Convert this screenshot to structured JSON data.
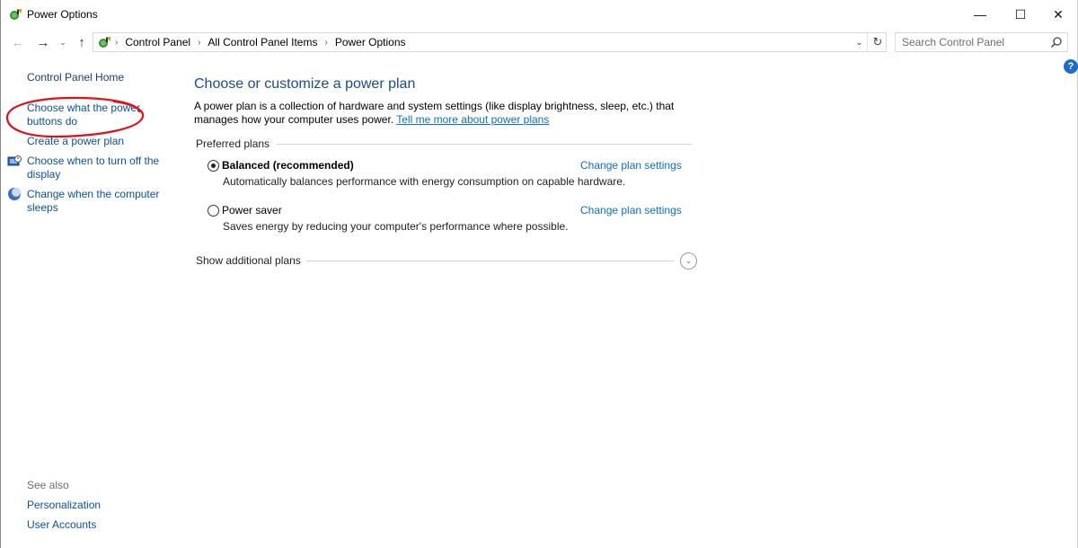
{
  "window": {
    "title": "Power Options",
    "minimize_glyph": "—",
    "maximize_glyph": "☐",
    "close_glyph": "✕"
  },
  "nav": {
    "back_glyph": "←",
    "forward_glyph": "→",
    "recent_glyph": "⌄",
    "up_glyph": "↑",
    "breadcrumb": [
      "Control Panel",
      "All Control Panel Items",
      "Power Options"
    ],
    "separator": "›",
    "dropdown_glyph": "⌄",
    "refresh_glyph": "↻"
  },
  "search": {
    "placeholder": "Search Control Panel"
  },
  "help": {
    "glyph": "?"
  },
  "sidebar": {
    "home": "Control Panel Home",
    "items": [
      "Choose what the power buttons do",
      "Create a power plan",
      "Choose when to turn off the display",
      "Change when the computer sleeps"
    ],
    "see_also_heading": "See also",
    "see_also": [
      "Personalization",
      "User Accounts"
    ]
  },
  "annotation": {
    "color": "#e0101a",
    "shape": "hand-drawn ellipse around sidebar item 1"
  },
  "main": {
    "title": "Choose or customize a power plan",
    "description": "A power plan is a collection of hardware and system settings (like display brightness, sleep, etc.) that manages how your computer uses power.",
    "learn_more": "Tell me more about power plans",
    "preferred_heading": "Preferred plans",
    "plans": [
      {
        "name": "Balanced (recommended)",
        "selected": true,
        "description": "Automatically balances performance with energy consumption on capable hardware.",
        "change_link": "Change plan settings"
      },
      {
        "name": "Power saver",
        "selected": false,
        "description": "Saves energy by reducing your computer's performance where possible.",
        "change_link": "Change plan settings"
      }
    ],
    "additional_label": "Show additional plans",
    "expand_glyph": "⌄"
  },
  "colors": {
    "link": "#0b6fc6",
    "title": "#1a4a8f",
    "help_badge": "#1e6bc6"
  }
}
